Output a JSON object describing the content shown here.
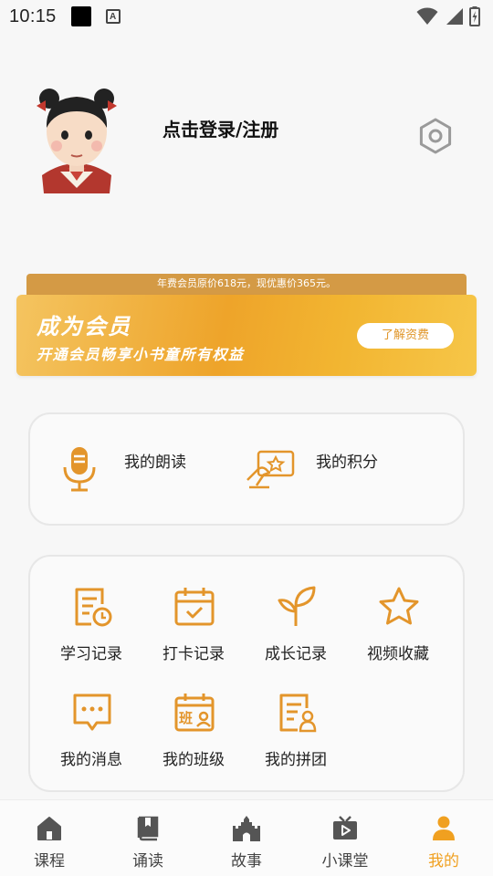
{
  "status_bar": {
    "time": "10:15",
    "a_label": "A"
  },
  "profile": {
    "login_text": "点击登录/注册"
  },
  "membership": {
    "price_note": "年费会员原价618元，现优惠价365元。",
    "title": "成为会员",
    "subtitle": "开通会员畅享小书童所有权益",
    "button": "了解资费"
  },
  "quick_actions": [
    {
      "label": "我的朗读",
      "icon": "microphone-icon"
    },
    {
      "label": "我的积分",
      "icon": "points-card-icon"
    }
  ],
  "grid": [
    {
      "label": "学习记录",
      "icon": "study-record-icon"
    },
    {
      "label": "打卡记录",
      "icon": "calendar-check-icon"
    },
    {
      "label": "成长记录",
      "icon": "sprout-icon"
    },
    {
      "label": "视频收藏",
      "icon": "star-icon"
    },
    {
      "label": "我的消息",
      "icon": "message-icon"
    },
    {
      "label": "我的班级",
      "icon": "class-icon",
      "glyph": "班"
    },
    {
      "label": "我的拼团",
      "icon": "group-buy-icon"
    }
  ],
  "nav": [
    {
      "label": "课程",
      "icon": "home-icon"
    },
    {
      "label": "诵读",
      "icon": "book-icon"
    },
    {
      "label": "故事",
      "icon": "castle-icon"
    },
    {
      "label": "小课堂",
      "icon": "tv-icon"
    },
    {
      "label": "我的",
      "icon": "user-icon",
      "active": true
    }
  ],
  "colors": {
    "accent": "#f0a020",
    "icon_orange": "#e3952b",
    "background": "#f7f7f7"
  }
}
